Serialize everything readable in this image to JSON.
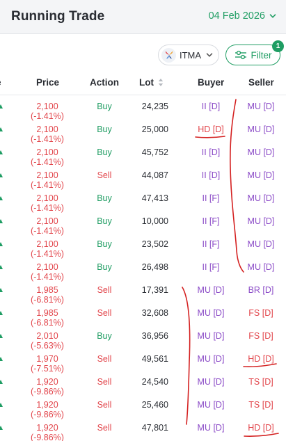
{
  "header": {
    "title": "Running Trade",
    "date": "04 Feb 2026"
  },
  "filter_bar": {
    "stock_code": "ITMA",
    "filter_label": "Filter",
    "filter_count": "1"
  },
  "table": {
    "columns": {
      "time": "e",
      "price": "Price",
      "action": "Action",
      "lot": "Lot",
      "buyer": "Buyer",
      "seller": "Seller"
    },
    "rows": [
      {
        "price": "2,100 (-1.41%)",
        "action": "Buy",
        "lot": "24,235",
        "buyer": "II [D]",
        "seller": "MU [D]"
      },
      {
        "price": "2,100 (-1.41%)",
        "action": "Buy",
        "lot": "25,000",
        "buyer": "HD [D]",
        "seller": "MU [D]"
      },
      {
        "price": "2,100 (-1.41%)",
        "action": "Buy",
        "lot": "45,752",
        "buyer": "II [D]",
        "seller": "MU [D]"
      },
      {
        "price": "2,100 (-1.41%)",
        "action": "Sell",
        "lot": "44,087",
        "buyer": "II [D]",
        "seller": "MU [D]"
      },
      {
        "price": "2,100 (-1.41%)",
        "action": "Buy",
        "lot": "47,413",
        "buyer": "II [F]",
        "seller": "MU [D]"
      },
      {
        "price": "2,100 (-1.41%)",
        "action": "Buy",
        "lot": "10,000",
        "buyer": "II [F]",
        "seller": "MU [D]"
      },
      {
        "price": "2,100 (-1.41%)",
        "action": "Buy",
        "lot": "23,502",
        "buyer": "II [F]",
        "seller": "MU [D]"
      },
      {
        "price": "2,100 (-1.41%)",
        "action": "Buy",
        "lot": "26,498",
        "buyer": "II [F]",
        "seller": "MU [D]"
      },
      {
        "price": "1,985 (-6.81%)",
        "action": "Sell",
        "lot": "17,391",
        "buyer": "MU [D]",
        "seller": "BR [D]"
      },
      {
        "price": "1,985 (-6.81%)",
        "action": "Sell",
        "lot": "32,608",
        "buyer": "MU [D]",
        "seller": "FS [D]"
      },
      {
        "price": "2,010 (-5.63%)",
        "action": "Buy",
        "lot": "36,956",
        "buyer": "MU [D]",
        "seller": "FS [D]"
      },
      {
        "price": "1,970 (-7.51%)",
        "action": "Sell",
        "lot": "49,561",
        "buyer": "MU [D]",
        "seller": "HD [D]"
      },
      {
        "price": "1,920 (-9.86%)",
        "action": "Sell",
        "lot": "24,540",
        "buyer": "MU [D]",
        "seller": "TS [D]"
      },
      {
        "price": "1,920 (-9.86%)",
        "action": "Sell",
        "lot": "25,460",
        "buyer": "MU [D]",
        "seller": "TS [D]"
      },
      {
        "price": "1,920 (-9.86%)",
        "action": "Sell",
        "lot": "47,801",
        "buyer": "MU [D]",
        "seller": "HD [D]"
      }
    ]
  },
  "colors": {
    "up_green": "#1f9d63",
    "down_red": "#e2454b",
    "foreign_purple": "#8b4bc7",
    "annotation_red": "#d42020"
  },
  "icons": {
    "date_chevron": "chevron-down-icon",
    "stock_logo": "itma-logo-icon",
    "filter": "sliders-icon",
    "sort": "sort-icon"
  }
}
